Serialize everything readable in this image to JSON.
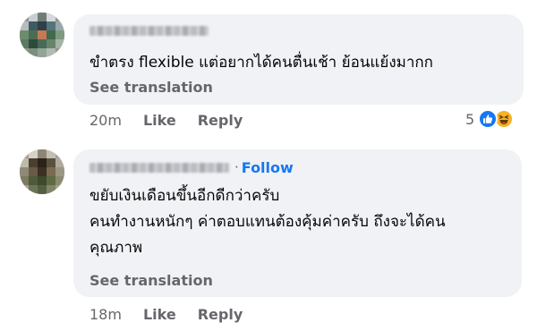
{
  "comments": [
    {
      "author_name": "",
      "follow_label": "",
      "text": "ขำตรง flexible แต่อยากได้คนตื่นเช้า ย้อนแย้งมากก",
      "see_translation": "See translation",
      "time": "20m",
      "like_label": "Like",
      "reply_label": "Reply",
      "reaction_count": "5",
      "reaction_icons": [
        "like-icon",
        "haha-icon"
      ]
    },
    {
      "author_name": "",
      "follow_separator": "·",
      "follow_label": "Follow",
      "text": "ขยับเงินเดือนขึ้นอีกดีกว่าครับ\nคนทำงานหนักๆ ค่าตอบแทนต้องคุ้มค่าครับ ถึงจะได้คน\nคุณภาพ",
      "see_translation": "See translation",
      "time": "18m",
      "like_label": "Like",
      "reply_label": "Reply"
    }
  ],
  "colors": {
    "bubble": "#f0f2f5",
    "secondary_text": "#65676b",
    "link": "#1877f2",
    "like_reaction": "#1877f2",
    "haha_reaction": "#f7b125"
  }
}
